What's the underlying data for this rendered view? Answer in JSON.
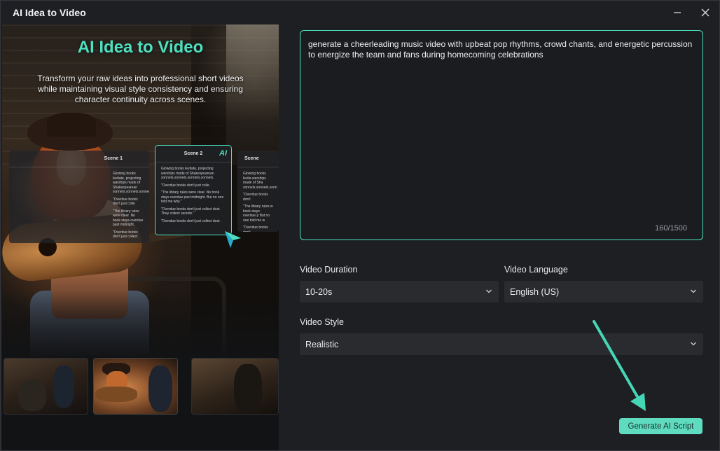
{
  "window": {
    "title": "AI Idea to Video"
  },
  "hero": {
    "title": "AI Idea to Video",
    "description": "Transform your raw ideas into professional short videos while maintaining visual style consistency and ensuring character continuity across scenes."
  },
  "scenes": [
    {
      "label": "Scene 1",
      "lines": [
        "Glowing books levitate, projecting warships made of Shakespearean sonnets.sonnets.sonnets.",
        "\"Overdue books don't just colle",
        "\"The library rules were clear. No book stays overdue past midnight.",
        "\"Overdue books don't just collect"
      ]
    },
    {
      "label": "Scene 2",
      "badge": "AI",
      "lines": [
        "Glowing books levitate, projecting warships made of Shakespearean sonnets.sonnets.sonnets.sonnets.",
        "\"Overdue books don't just colle.",
        "\"The library rules were clear. No book stays overdue past midnight. But no one told me why.\"",
        "\"Overdue books don't just collect dust. They collect secrets.\"",
        "\"Overdue books don't just collect dust."
      ]
    },
    {
      "label": "Scene",
      "lines": [
        "Glowing books levita warships made of Sha sonnets.sonnets.sonn",
        "\"Overdue books don't",
        "\"The library rules w book stays overdue p But no one told me w",
        "\"Overdue books don't"
      ]
    }
  ],
  "prompt": {
    "text": "generate a cheerleading music video with upbeat pop rhythms, crowd chants, and energetic percussion to energize the team and fans during homecoming celebrations",
    "counter": "160/1500"
  },
  "settings": {
    "duration_label": "Video Duration",
    "duration_value": "10-20s",
    "language_label": "Video Language",
    "language_value": "English (US)",
    "style_label": "Video Style",
    "style_value": "Realistic"
  },
  "actions": {
    "generate_label": "Generate AI Script"
  },
  "colors": {
    "accent": "#4de0c0",
    "button": "#5fdcc0",
    "background": "#1e1f23",
    "select_bg": "#2a2b2f"
  },
  "icons": {
    "minimize": "minimize-icon",
    "close": "close-icon",
    "dropdown": "chevron-down-icon",
    "cursor": "ai-cursor-icon",
    "annotation": "arrow-annotation"
  }
}
